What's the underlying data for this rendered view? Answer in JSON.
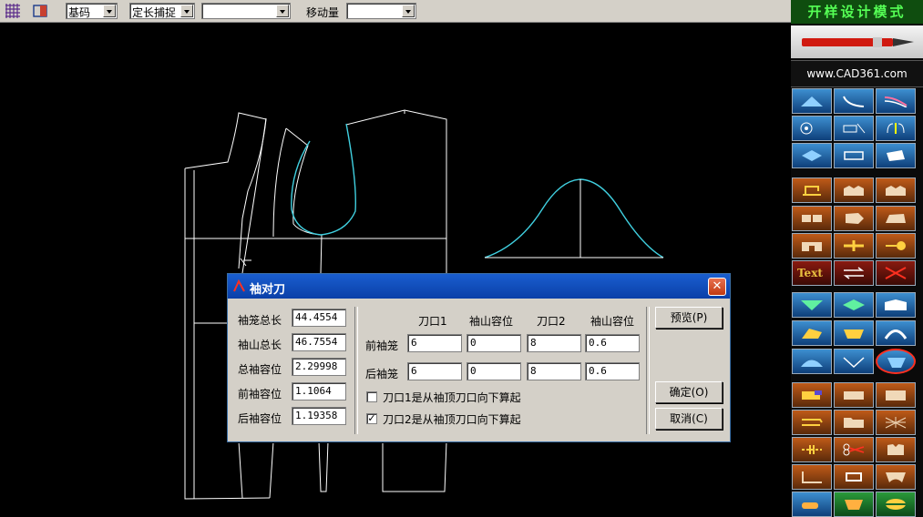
{
  "toolbar": {
    "combo1": {
      "value": "基码"
    },
    "combo2": {
      "value": "定长捕捉"
    },
    "combo3": {
      "value": ""
    },
    "move_label": "移动量",
    "combo4": {
      "value": ""
    }
  },
  "right_panel": {
    "mode_title": "开样设计模式",
    "url": "www.CAD361.com",
    "text_tool_label": "Text"
  },
  "dialog": {
    "title": "袖对刀",
    "close": "✕",
    "left_fields": [
      {
        "label": "袖笼总长",
        "value": "44.4554"
      },
      {
        "label": "袖山总长",
        "value": "46.7554"
      },
      {
        "label": "总袖容位",
        "value": "2.29998"
      },
      {
        "label": "前袖容位",
        "value": "1.1064"
      },
      {
        "label": "后袖容位",
        "value": "1.19358"
      }
    ],
    "col_headers": [
      "刀口1",
      "袖山容位",
      "刀口2",
      "袖山容位"
    ],
    "rows": [
      {
        "label": "前袖笼",
        "values": [
          "6",
          "0",
          "8",
          "0.6"
        ]
      },
      {
        "label": "后袖笼",
        "values": [
          "6",
          "0",
          "8",
          "0.6"
        ]
      }
    ],
    "checks": [
      {
        "label": "刀口1是从袖顶刀口向下算起",
        "checked": false
      },
      {
        "label": "刀口2是从袖顶刀口向下算起",
        "checked": true
      }
    ],
    "buttons": {
      "preview": "预览(P)",
      "ok": "确定(O)",
      "cancel": "取消(C)"
    }
  },
  "colors": {
    "canvas": "#000000",
    "pattern_lines": "#ffffff",
    "sleeve_curve": "#40d0e0",
    "panel_bg": "#d4d0c8",
    "title_bar": "#0a3fa8"
  }
}
